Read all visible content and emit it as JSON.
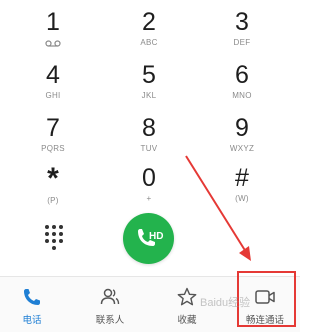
{
  "keys": [
    {
      "digit": "1",
      "sub": ""
    },
    {
      "digit": "2",
      "sub": "ABC"
    },
    {
      "digit": "3",
      "sub": "DEF"
    },
    {
      "digit": "4",
      "sub": "GHI"
    },
    {
      "digit": "5",
      "sub": "JKL"
    },
    {
      "digit": "6",
      "sub": "MNO"
    },
    {
      "digit": "7",
      "sub": "PQRS"
    },
    {
      "digit": "8",
      "sub": "TUV"
    },
    {
      "digit": "9",
      "sub": "WXYZ"
    },
    {
      "digit": "*",
      "sub": "(P)"
    },
    {
      "digit": "0",
      "sub": "+"
    },
    {
      "digit": "#",
      "sub": "(W)"
    }
  ],
  "voicemail_icon": "voicemail-icon",
  "call_button": {
    "label": "HD",
    "color": "#23b34d",
    "icon": "phone-icon"
  },
  "tabs": [
    {
      "label": "电话",
      "icon": "phone-icon",
      "active": true
    },
    {
      "label": "联系人",
      "icon": "contacts-icon",
      "active": false
    },
    {
      "label": "收藏",
      "icon": "star-icon",
      "active": false
    },
    {
      "label": "畅连通话",
      "icon": "video-call-icon",
      "active": false
    }
  ],
  "watermark": "Baidu经验",
  "colors": {
    "accent": "#1f7fd4",
    "call_green": "#23b34d",
    "annotation_red": "#e53935"
  }
}
